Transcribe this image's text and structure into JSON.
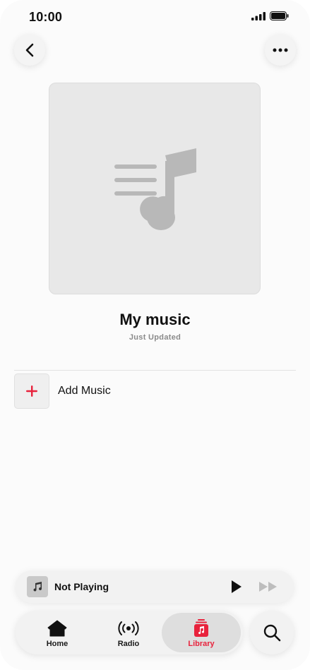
{
  "status_bar": {
    "time": "10:00"
  },
  "header": {
    "back_icon": "chevron-left-icon",
    "more_icon": "ellipsis-icon"
  },
  "playlist": {
    "artwork_icon": "music-note-list-icon",
    "title": "My music",
    "subtitle": "Just Updated"
  },
  "actions": {
    "add_music_label": "Add Music",
    "add_icon": "plus-icon"
  },
  "mini_player": {
    "title": "Not Playing"
  },
  "tab_bar": {
    "tabs": [
      {
        "label": "Home",
        "icon": "house-icon"
      },
      {
        "label": "Radio",
        "icon": "broadcast-icon"
      },
      {
        "label": "Library",
        "icon": "library-icon",
        "selected": true
      }
    ],
    "search_icon": "search-icon"
  },
  "colors": {
    "accent": "#e8223c",
    "background": "#fbfbfb",
    "artwork": "#e8e8e8"
  }
}
